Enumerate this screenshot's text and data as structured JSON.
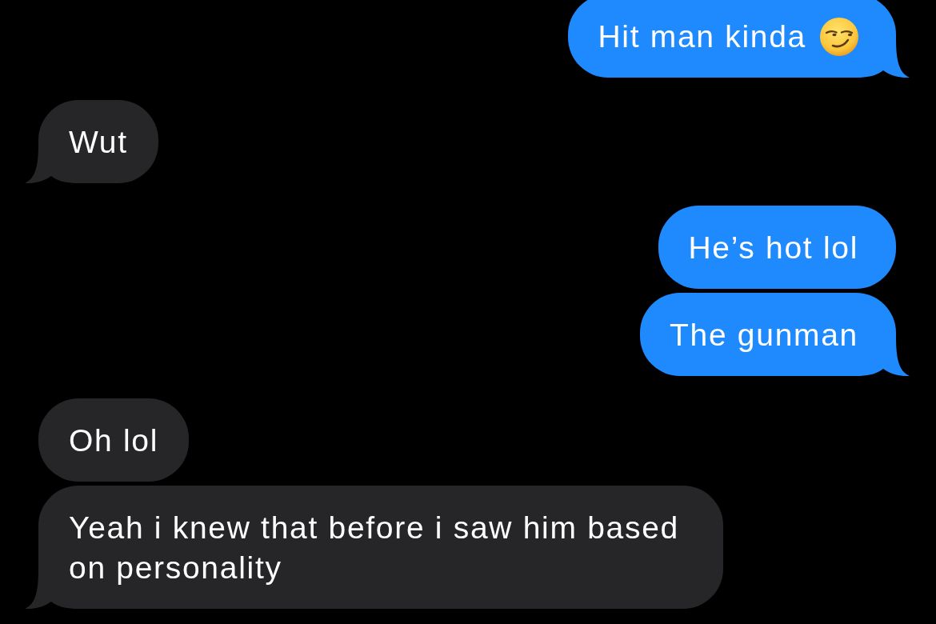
{
  "messages": [
    {
      "kind": "sent",
      "text": "Hit man kinda",
      "emoji": true,
      "tail": true
    },
    {
      "kind": "received",
      "text": "Wut",
      "emoji": false,
      "tail": true
    },
    {
      "kind": "sent",
      "text": "He’s hot lol",
      "emoji": false,
      "tail": false
    },
    {
      "kind": "sent",
      "text": "The gunman",
      "emoji": false,
      "tail": true
    },
    {
      "kind": "received",
      "text": "Oh lol",
      "emoji": false,
      "tail": false
    },
    {
      "kind": "received",
      "text": "Yeah i knew that before i saw him based on personality",
      "emoji": false,
      "tail": true
    }
  ]
}
